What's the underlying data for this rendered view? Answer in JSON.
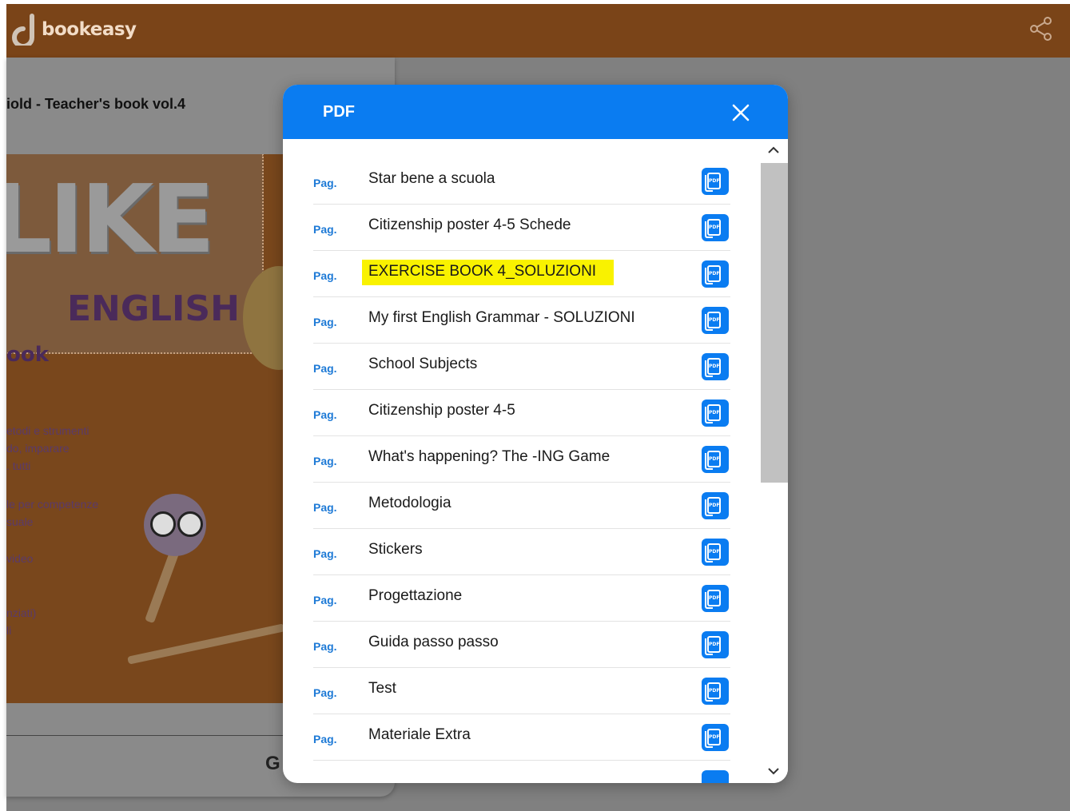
{
  "app": {
    "logo_text": "bookeasy",
    "share_icon": "share-icon"
  },
  "book": {
    "title": "iold - Teacher's book vol.4",
    "cover_big": "LIKE",
    "cover_sub": "ENGLISH",
    "cover_ook": "ook",
    "cover_lines": [
      "etodi e strumenti",
      "do, imparare",
      ". tutti",
      "le per competenze",
      "suale",
      "video",
      "nziati)",
      "li"
    ],
    "bottom_letter": "G"
  },
  "modal": {
    "title": "PDF",
    "close_icon": "close-icon",
    "page_prefix": "Pag.",
    "items": [
      {
        "label": "Star bene a scuola"
      },
      {
        "label": "Citizenship poster 4-5 Schede"
      },
      {
        "label": "EXERCISE BOOK 4_SOLUZIONI",
        "highlighted": true
      },
      {
        "label": "My first English Grammar - SOLUZIONI"
      },
      {
        "label": "School Subjects"
      },
      {
        "label": "Citizenship poster 4-5"
      },
      {
        "label": "What's happening? The -ING Game"
      },
      {
        "label": "Metodologia"
      },
      {
        "label": "Stickers"
      },
      {
        "label": "Progettazione"
      },
      {
        "label": "Guida passo passo"
      },
      {
        "label": "Test"
      },
      {
        "label": "Materiale Extra"
      }
    ],
    "pdf_icon_text": "PDF"
  },
  "colors": {
    "topbar": "#7a4418",
    "accent": "#0a7cf1",
    "highlight": "#f9f200",
    "overlay": "#808080"
  }
}
